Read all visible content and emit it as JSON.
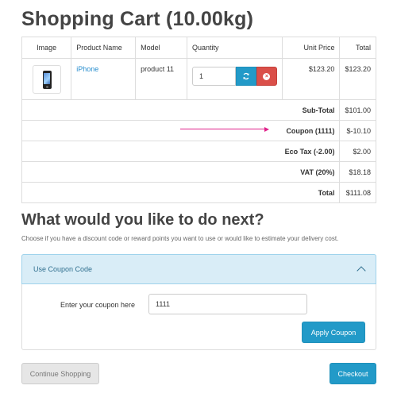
{
  "page": {
    "title": "Shopping Cart (10.00kg)"
  },
  "table": {
    "headers": {
      "image": "Image",
      "product_name": "Product Name",
      "model": "Model",
      "quantity": "Quantity",
      "unit_price": "Unit Price",
      "total": "Total"
    },
    "product": {
      "image_icon": "iphone-thumbnail",
      "name": "iPhone",
      "model": "product 11",
      "quantity": "1",
      "unit_price": "$123.20",
      "total": "$123.20"
    },
    "summary": [
      {
        "label": "Sub-Total",
        "value": "$101.00"
      },
      {
        "label": "Coupon (1111)",
        "value": "$-10.10"
      },
      {
        "label": "Eco Tax (-2.00)",
        "value": "$2.00"
      },
      {
        "label": "VAT (20%)",
        "value": "$18.18"
      },
      {
        "label": "Total",
        "value": "$111.08"
      }
    ]
  },
  "annotation": {
    "arrow_color": "#e0218a"
  },
  "next": {
    "title": "What would you like to do next?",
    "description": "Choose if you have a discount code or reward points you want to use or would like to estimate your delivery cost."
  },
  "coupon": {
    "panel_title": "Use Coupon Code",
    "label": "Enter your coupon here",
    "value": "1111",
    "apply_label": "Apply Coupon"
  },
  "actions": {
    "continue_label": "Continue Shopping",
    "checkout_label": "Checkout"
  },
  "colors": {
    "primary": "#229ac8",
    "danger": "#da4f49",
    "panel_bg": "#d9edf7",
    "link": "#2a8fcf"
  }
}
